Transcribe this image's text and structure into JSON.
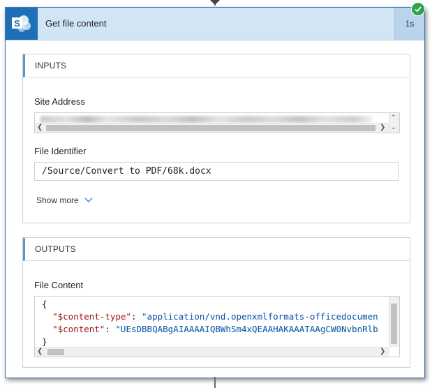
{
  "card": {
    "title": "Get file content",
    "duration": "1s",
    "status": "success",
    "accent_color": "#1e6fb8",
    "success_color": "#30a250"
  },
  "inputs": {
    "header": "INPUTS",
    "site_address_label": "Site Address",
    "file_identifier_label": "File Identifier",
    "file_identifier_value": "/Source/Convert to PDF/68k.docx",
    "show_more_label": "Show more"
  },
  "outputs": {
    "header": "OUTPUTS",
    "file_content_label": "File Content",
    "code": {
      "open_brace": "{",
      "line1_key": "\"$content-type\"",
      "line1_value": "\"application/vnd.openxmlformats-officedocumen",
      "line2_key": "\"$content\"",
      "line2_value": "\"UEsDBBQABgAIAAAAIQBWhSm4xQEAAHAKAAATAAgCW0NvbnRlb",
      "close_brace": "}"
    }
  },
  "icons": {
    "logo": "sharepoint-icon",
    "status": "check-icon",
    "expand": "chevron-down-icon"
  }
}
